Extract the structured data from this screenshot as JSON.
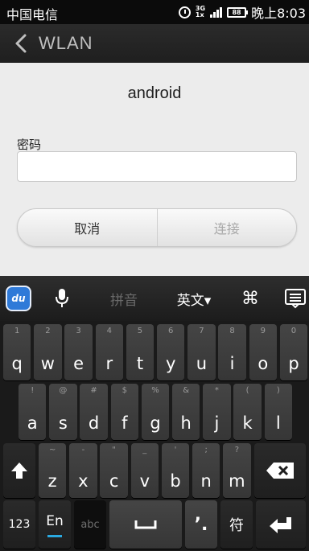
{
  "status_bar": {
    "carrier": "中国电信",
    "network_top": "3G",
    "network_bottom": "1x",
    "battery": "88",
    "time": "晚上8:03"
  },
  "title_bar": {
    "title": "WLAN"
  },
  "dialog": {
    "ssid": "android",
    "password_label": "密码",
    "password_value": "",
    "cancel_label": "取消",
    "connect_label": "连接"
  },
  "keyboard_toolbar": {
    "logo_text": "du",
    "pinyin_label": "拼音",
    "english_label": "英文▾",
    "cmd_glyph": "⌘"
  },
  "keyboard": {
    "row1": [
      {
        "hint": "1",
        "key": "q"
      },
      {
        "hint": "2",
        "key": "w"
      },
      {
        "hint": "3",
        "key": "e"
      },
      {
        "hint": "4",
        "key": "r"
      },
      {
        "hint": "5",
        "key": "t"
      },
      {
        "hint": "6",
        "key": "y"
      },
      {
        "hint": "7",
        "key": "u"
      },
      {
        "hint": "8",
        "key": "i"
      },
      {
        "hint": "9",
        "key": "o"
      },
      {
        "hint": "0",
        "key": "p"
      }
    ],
    "row2": [
      {
        "hint": "!",
        "key": "a"
      },
      {
        "hint": "@",
        "key": "s"
      },
      {
        "hint": "#",
        "key": "d"
      },
      {
        "hint": "$",
        "key": "f"
      },
      {
        "hint": "%",
        "key": "g"
      },
      {
        "hint": "&",
        "key": "h"
      },
      {
        "hint": "*",
        "key": "j"
      },
      {
        "hint": "(",
        "key": "k"
      },
      {
        "hint": ")",
        "key": "l"
      }
    ],
    "row3": [
      {
        "hint": "~",
        "key": "z"
      },
      {
        "hint": "-",
        "key": "x"
      },
      {
        "hint": "\"",
        "key": "c"
      },
      {
        "hint": "_",
        "key": "v"
      },
      {
        "hint": "'",
        "key": "b"
      },
      {
        "hint": ";",
        "key": "n"
      },
      {
        "hint": "?",
        "key": "m"
      }
    ],
    "num_label": "123",
    "en_label": "En",
    "abc_label": "abc",
    "punct_label": "’.",
    "fu_label": "符"
  },
  "colors": {
    "accent": "#2aa9e0",
    "du_blue": "#2f7ad8",
    "dialog_bg": "#ececec"
  }
}
